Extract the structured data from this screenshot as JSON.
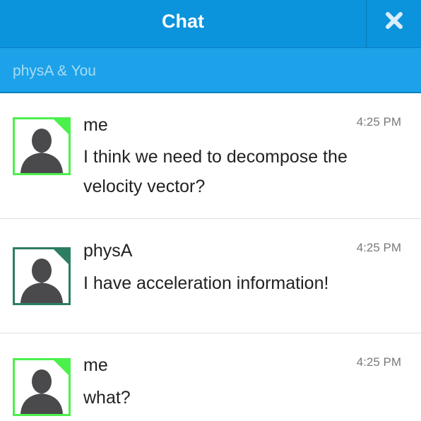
{
  "header": {
    "title": "Chat",
    "close_icon": "close-icon"
  },
  "conversation": {
    "participants": "physA & You"
  },
  "colors": {
    "header_bg": "#0b93dc",
    "subheader_bg": "#1da1e8",
    "me_avatar_accent": "#4cf04c",
    "other_avatar_accent": "#2c7d63"
  },
  "messages": [
    {
      "sender": "me",
      "time": "4:25 PM",
      "text": "I think we need to decompose the velocity vector?",
      "avatar_icon": "user-avatar-icon"
    },
    {
      "sender": "physA",
      "time": "4:25 PM",
      "text": "I have acceleration information!",
      "avatar_icon": "user-avatar-icon"
    },
    {
      "sender": "me",
      "time": "4:25 PM",
      "text": "what?",
      "avatar_icon": "user-avatar-icon"
    }
  ]
}
